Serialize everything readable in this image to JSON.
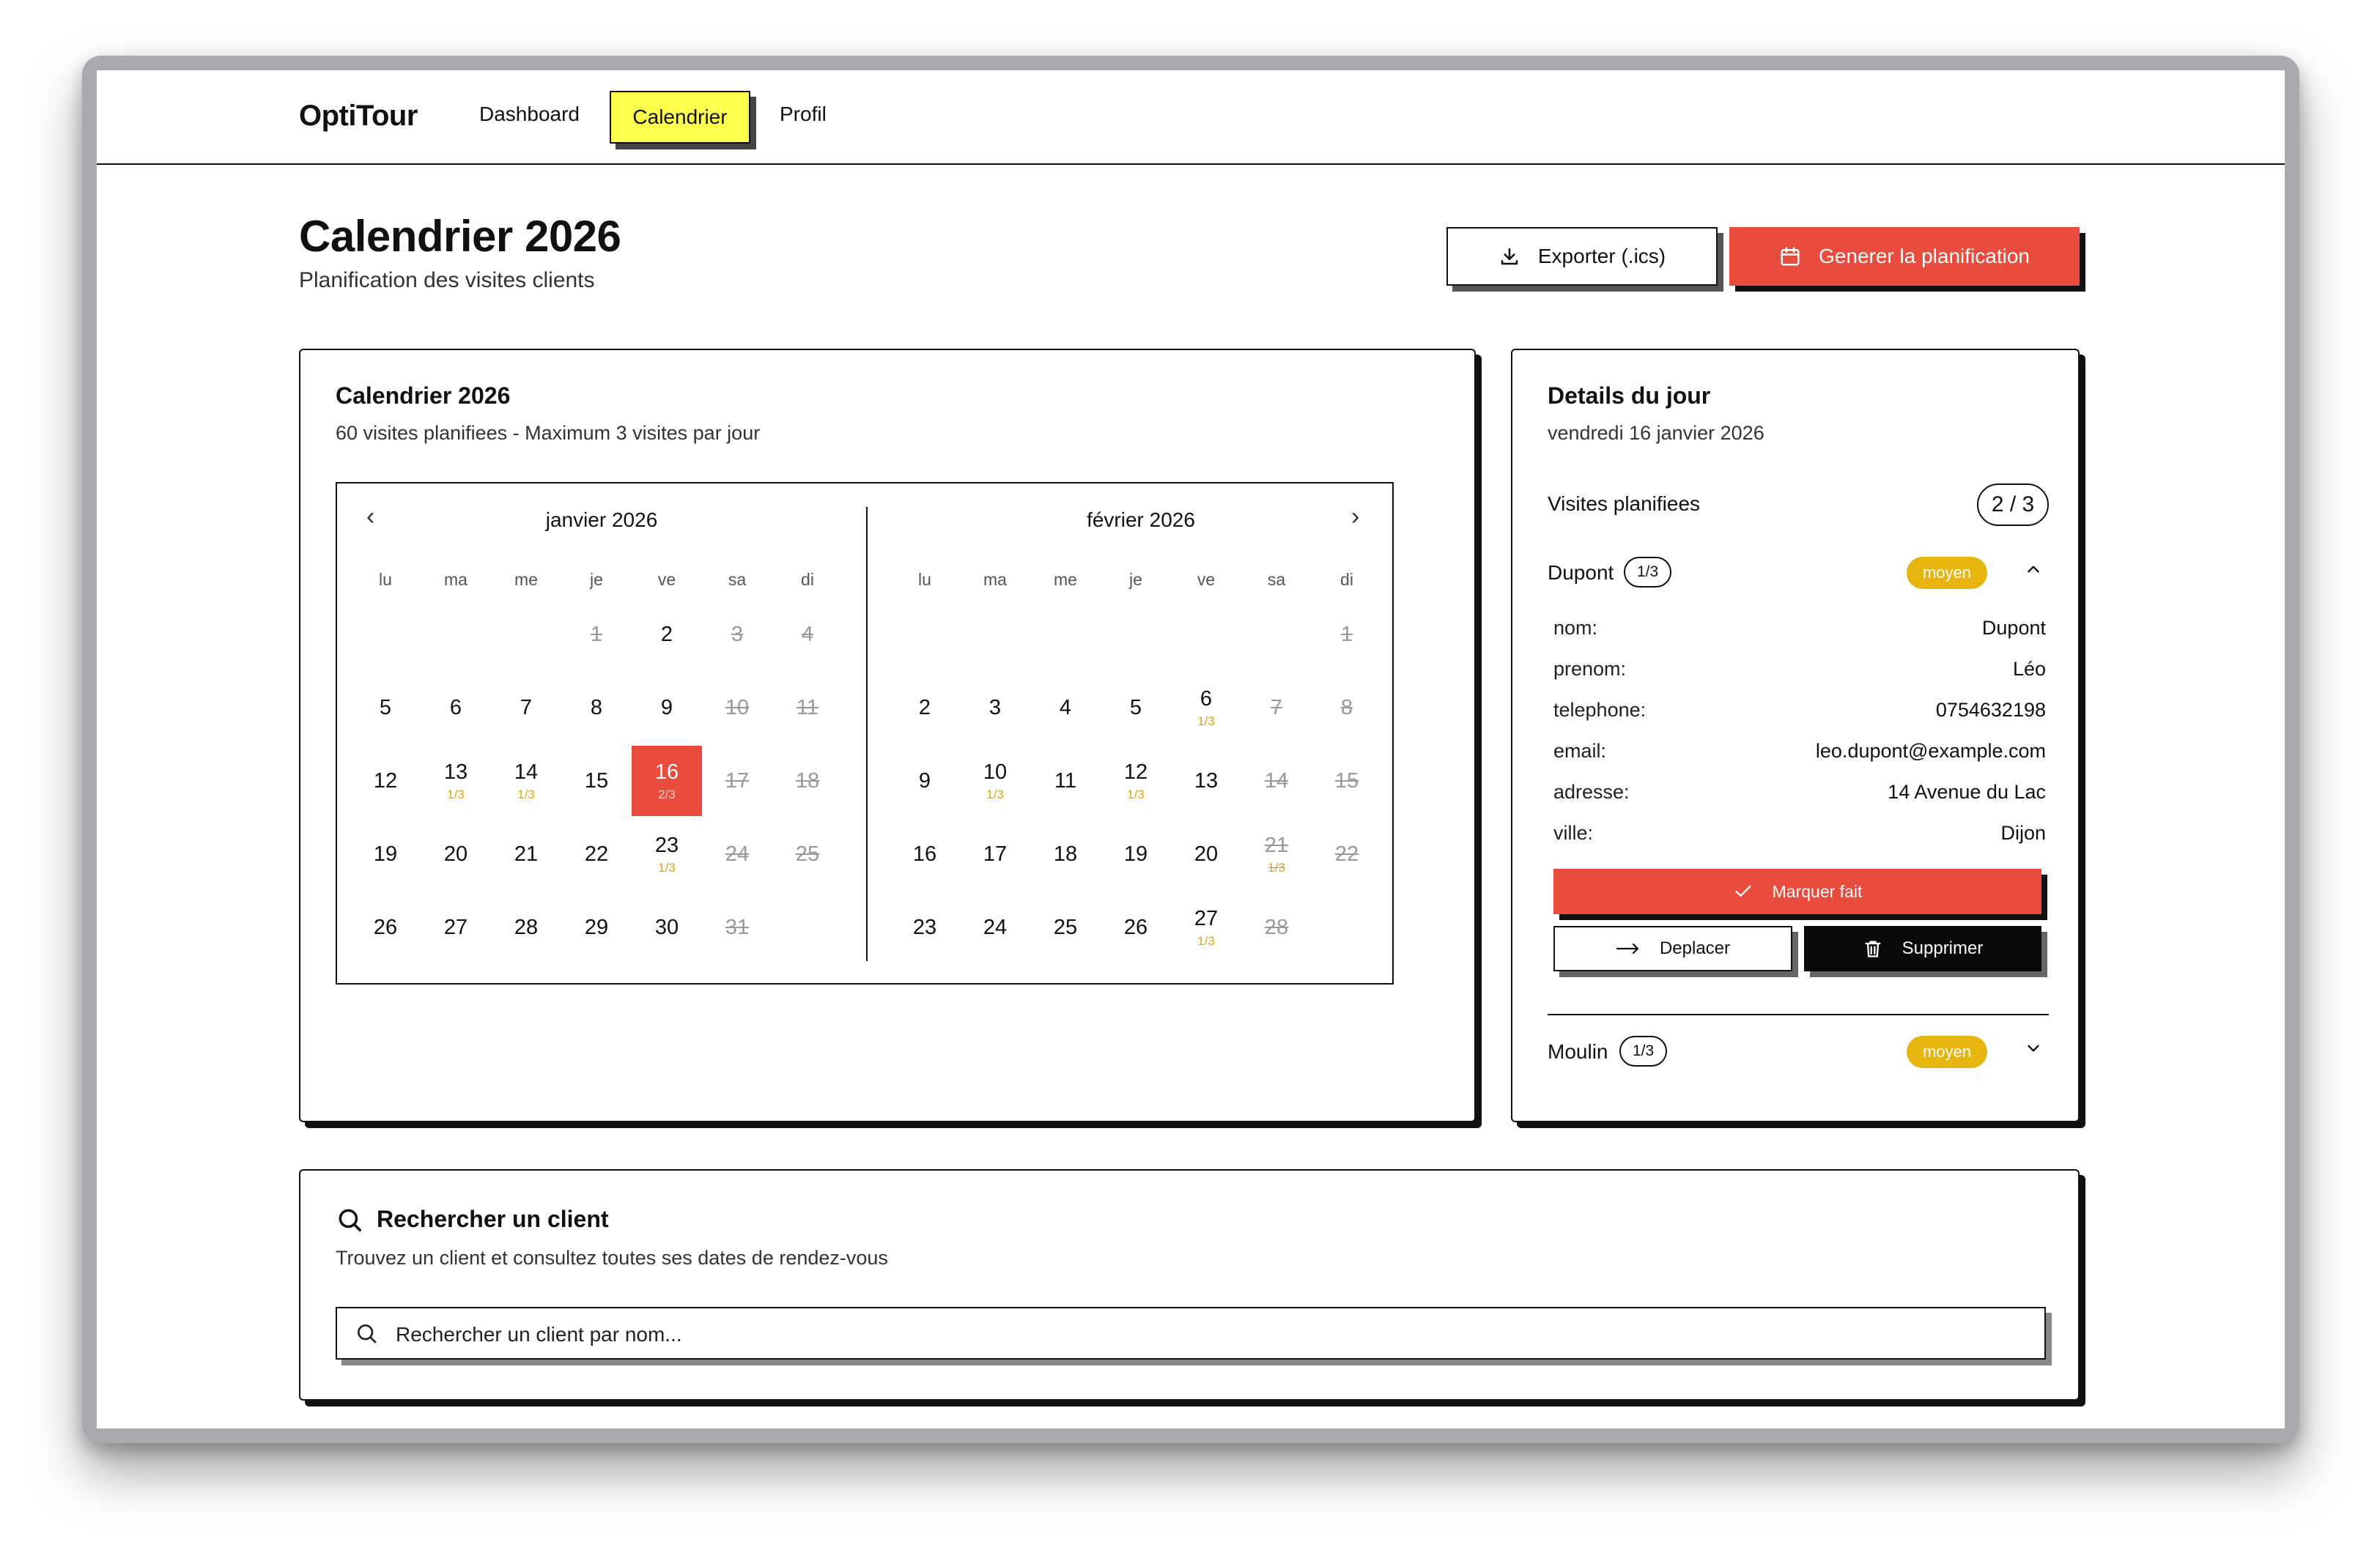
{
  "nav": {
    "logo": "OptiTour",
    "links": [
      "Dashboard",
      "Calendrier",
      "Profil"
    ]
  },
  "header": {
    "title": "Calendrier 2026",
    "subtitle": "Planification des visites clients",
    "export_label": "Exporter (.ics)",
    "generate_label": "Generer la planification"
  },
  "calendar": {
    "title": "Calendrier 2026",
    "subtitle": "60 visites planifiees - Maximum 3 visites par jour",
    "weekdays": [
      "lu",
      "ma",
      "me",
      "je",
      "ve",
      "sa",
      "di"
    ],
    "months": [
      {
        "name": "janvier 2026",
        "offset": 3,
        "days": [
          {
            "d": "1",
            "off": true
          },
          {
            "d": "2"
          },
          {
            "d": "3",
            "off": true
          },
          {
            "d": "4",
            "off": true
          },
          {
            "d": "5"
          },
          {
            "d": "6"
          },
          {
            "d": "7"
          },
          {
            "d": "8"
          },
          {
            "d": "9"
          },
          {
            "d": "10",
            "off": true
          },
          {
            "d": "11",
            "off": true
          },
          {
            "d": "12"
          },
          {
            "d": "13",
            "load": "1/3"
          },
          {
            "d": "14",
            "load": "1/3"
          },
          {
            "d": "15"
          },
          {
            "d": "16",
            "load": "2/3",
            "selected": true
          },
          {
            "d": "17",
            "off": true
          },
          {
            "d": "18",
            "off": true
          },
          {
            "d": "19"
          },
          {
            "d": "20"
          },
          {
            "d": "21"
          },
          {
            "d": "22"
          },
          {
            "d": "23",
            "load": "1/3"
          },
          {
            "d": "24",
            "off": true
          },
          {
            "d": "25",
            "off": true
          },
          {
            "d": "26"
          },
          {
            "d": "27"
          },
          {
            "d": "28"
          },
          {
            "d": "29"
          },
          {
            "d": "30"
          },
          {
            "d": "31",
            "off": true
          }
        ]
      },
      {
        "name": "février 2026",
        "offset": 6,
        "days": [
          {
            "d": "1",
            "off": true
          },
          {
            "d": "2"
          },
          {
            "d": "3"
          },
          {
            "d": "4"
          },
          {
            "d": "5"
          },
          {
            "d": "6",
            "load": "1/3"
          },
          {
            "d": "7",
            "off": true
          },
          {
            "d": "8",
            "off": true
          },
          {
            "d": "9"
          },
          {
            "d": "10",
            "load": "1/3"
          },
          {
            "d": "11"
          },
          {
            "d": "12",
            "load": "1/3"
          },
          {
            "d": "13"
          },
          {
            "d": "14",
            "off": true
          },
          {
            "d": "15",
            "off": true
          },
          {
            "d": "16"
          },
          {
            "d": "17"
          },
          {
            "d": "18"
          },
          {
            "d": "19"
          },
          {
            "d": "20"
          },
          {
            "d": "21",
            "off": true,
            "load": "1/3"
          },
          {
            "d": "22",
            "off": true
          },
          {
            "d": "23"
          },
          {
            "d": "24"
          },
          {
            "d": "25"
          },
          {
            "d": "26"
          },
          {
            "d": "27",
            "load": "1/3"
          },
          {
            "d": "28",
            "off": true
          }
        ]
      }
    ]
  },
  "details": {
    "title": "Details du jour",
    "date": "vendredi 16 janvier 2026",
    "visits_label": "Visites planifiees",
    "visits_count": "2 / 3",
    "clients": [
      {
        "name": "Dupont",
        "badge": "1/3",
        "level": "moyen",
        "expanded": true
      },
      {
        "name": "Moulin",
        "badge": "1/3",
        "level": "moyen",
        "expanded": false
      }
    ],
    "fields": [
      {
        "k": "nom:",
        "v": "Dupont"
      },
      {
        "k": "prenom:",
        "v": "Léo"
      },
      {
        "k": "telephone:",
        "v": "0754632198"
      },
      {
        "k": "email:",
        "v": "leo.dupont@example.com"
      },
      {
        "k": "adresse:",
        "v": "14 Avenue du Lac"
      },
      {
        "k": "ville:",
        "v": "Dijon"
      }
    ],
    "done_label": "Marquer fait",
    "move_label": "Deplacer",
    "delete_label": "Supprimer"
  },
  "search": {
    "title": "Rechercher un client",
    "subtitle": "Trouvez un client et consultez toutes ses dates de rendez-vous",
    "placeholder": "Rechercher un client par nom..."
  },
  "colors": {
    "accent": "#e94b3c",
    "highlight": "#ffff4d",
    "level": "#e8b40e",
    "load": "#e7a400"
  }
}
